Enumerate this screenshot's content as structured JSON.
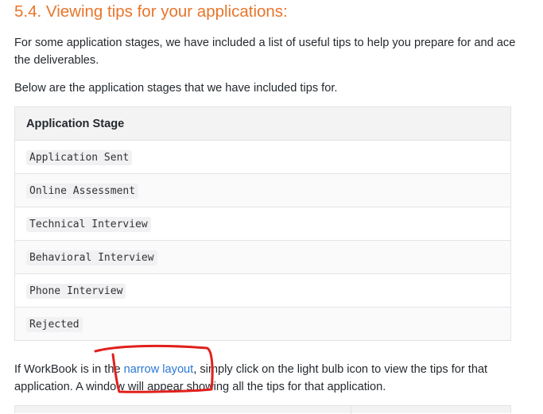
{
  "section": {
    "title": "5.4. Viewing tips for your applications:",
    "intro": "For some application stages, we have included a list of useful tips to help you prepare for and ace the deliverables.",
    "list_intro": "Below are the application stages that we have included tips for."
  },
  "stages_table": {
    "header": "Application Stage",
    "rows": [
      "Application Sent",
      "Online Assessment",
      "Technical Interview",
      "Behavioral Interview",
      "Phone Interview",
      "Rejected"
    ]
  },
  "narrow_para": {
    "before": "If WorkBook is in the ",
    "link": "narrow layout",
    "after": ", simply click on the light bulb icon to view the tips for that application. A window will appear showing all the tips for that application."
  },
  "annotation": {
    "color": "#e0201c"
  }
}
